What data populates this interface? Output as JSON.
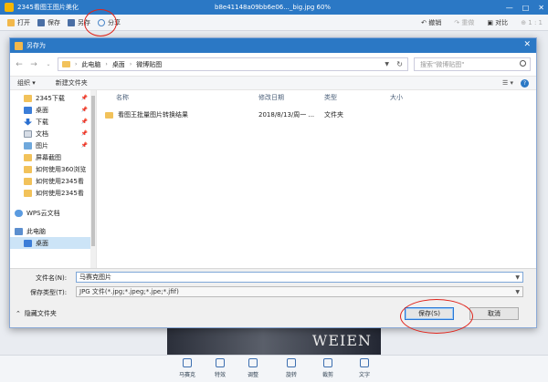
{
  "app": {
    "title": "2345看图王图片美化",
    "file_title": "b8e41148a09bb6e06..._big.jpg  60%",
    "toolbar": {
      "open": "打开",
      "save": "保存",
      "save_as": "另存",
      "share": "分享",
      "compare": "对比",
      "zoom": "1 : 1",
      "undo": "撤销",
      "redo": "重做"
    },
    "bottom": [
      "马赛克",
      "特效",
      "调整",
      "旋转",
      "裁剪",
      "文字"
    ],
    "photo_text": "WEIEN"
  },
  "dialog": {
    "title": "另存为",
    "address": {
      "crumbs": [
        "此电脑",
        "桌面",
        "微博贴图"
      ]
    },
    "search_placeholder": "搜索\"微博贴图\"",
    "commands": {
      "organize": "组织 ▾",
      "new_folder": "新建文件夹"
    },
    "nav_items": [
      {
        "label": "2345下载",
        "icon": "folder-icon"
      },
      {
        "label": "桌面",
        "icon": "desktop-icon"
      },
      {
        "label": "下载",
        "icon": "download-icon"
      },
      {
        "label": "文档",
        "icon": "document-icon"
      },
      {
        "label": "图片",
        "icon": "picture-icon"
      },
      {
        "label": "屏幕截图",
        "icon": "folder-icon"
      },
      {
        "label": "如何使用360浏览",
        "icon": "folder-icon"
      },
      {
        "label": "如何使用2345看",
        "icon": "folder-icon"
      },
      {
        "label": "如何使用2345看",
        "icon": "folder-icon"
      },
      {
        "label": "WPS云文档",
        "icon": "cloud-icon"
      },
      {
        "label": "此电脑",
        "icon": "computer-icon"
      },
      {
        "label": "桌面",
        "icon": "desktop-icon"
      }
    ],
    "columns": {
      "name": "名称",
      "modified": "修改日期",
      "type": "类型",
      "size": "大小"
    },
    "files": [
      {
        "name": "看图王批量图片转换结果",
        "modified": "2018/8/13/周一 ...",
        "type": "文件夹",
        "size": ""
      }
    ],
    "filename_label": "文件名(N):",
    "filename_value": "马赛克图片",
    "filetype_label": "保存类型(T):",
    "filetype_value": "JPG 文件(*.jpg;*.jpeg;*.jpe;*.jfif)",
    "hide_folders": "隐藏文件夹",
    "save_button": "保存(S)",
    "cancel_button": "取消"
  },
  "colors": {
    "titlebar": "#2b78c5",
    "annotation": "#e0231a",
    "selected": "#cce4f7"
  }
}
